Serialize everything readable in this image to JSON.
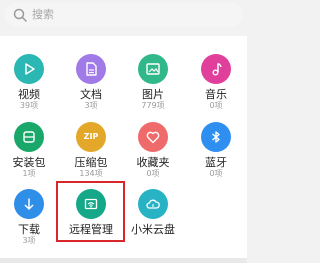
{
  "search": {
    "placeholder": "搜索"
  },
  "categories": [
    {
      "label": "视频",
      "count": "39项",
      "icon": "play-icon",
      "color": "#2bb7b4"
    },
    {
      "label": "文档",
      "count": "3项",
      "icon": "document-icon",
      "color": "#a07ae6"
    },
    {
      "label": "图片",
      "count": "779项",
      "icon": "image-icon",
      "color": "#30b88a"
    },
    {
      "label": "音乐",
      "count": "0项",
      "icon": "music-note-icon",
      "color": "#e0409b"
    },
    {
      "label": "安装包",
      "count": "1项",
      "icon": "package-icon",
      "color": "#1aa86a"
    },
    {
      "label": "压缩包",
      "count": "134项",
      "icon": "zip-icon",
      "color": "#e3a829",
      "icon_text": "ZIP"
    },
    {
      "label": "收藏夹",
      "count": "0项",
      "icon": "heart-icon",
      "color": "#ef6a6a"
    },
    {
      "label": "蓝牙",
      "count": "0项",
      "icon": "bluetooth-icon",
      "color": "#2f8ff0"
    },
    {
      "label": "下载",
      "count": "3项",
      "icon": "download-arrow-icon",
      "color": "#2e8ee8"
    },
    {
      "label": "远程管理",
      "count": "",
      "icon": "wifi-icon",
      "color": "#15a888"
    },
    {
      "label": "小米云盘",
      "count": "",
      "icon": "cloud-icon",
      "color": "#27b3c4"
    }
  ],
  "highlight_color": "#d9262a"
}
